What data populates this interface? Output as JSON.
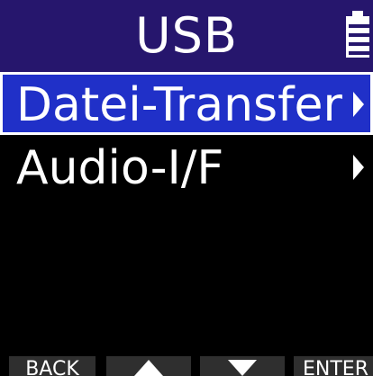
{
  "header": {
    "title": "USB",
    "battery_icon": "battery-icon"
  },
  "menu": {
    "items": [
      {
        "label": "Datei-Transfer",
        "selected": true,
        "icon": "chevron-right-icon"
      },
      {
        "label": "Audio-I/F",
        "selected": false,
        "icon": "chevron-right-icon"
      }
    ]
  },
  "footer": {
    "back_label": "BACK",
    "up_icon": "arrow-up-icon",
    "down_icon": "arrow-down-icon",
    "enter_label": "ENTER"
  },
  "colors": {
    "header_bg": "#26166d",
    "selected_bg": "#2030c8",
    "footer_button_bg": "#2f2f2f"
  }
}
